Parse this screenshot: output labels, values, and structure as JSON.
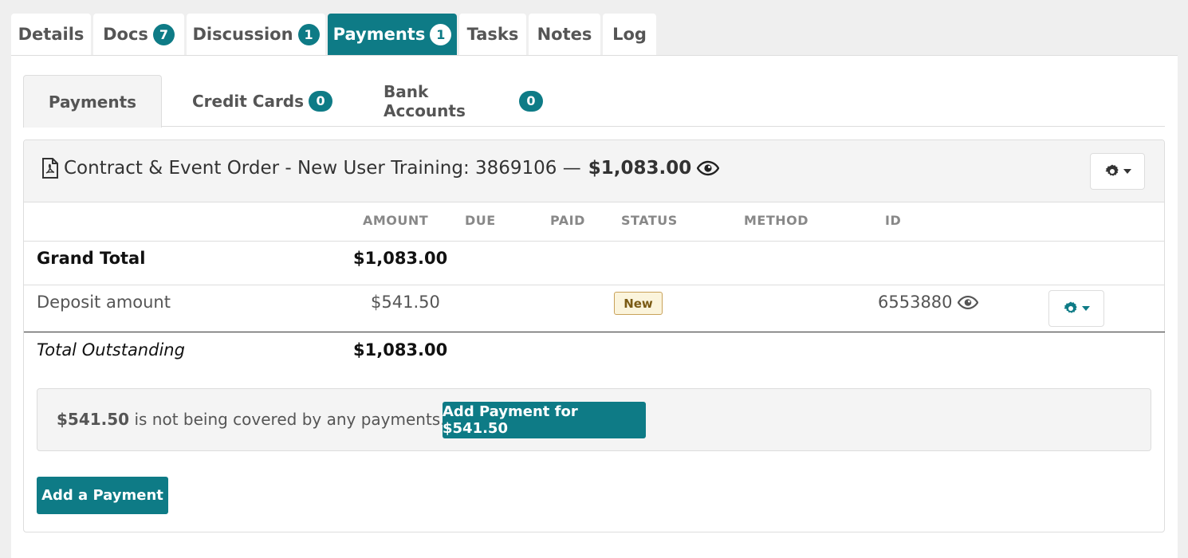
{
  "top_tabs": [
    {
      "label": "Details",
      "badge": ""
    },
    {
      "label": "Docs",
      "badge": "7"
    },
    {
      "label": "Discussion",
      "badge": "1"
    },
    {
      "label": "Payments",
      "badge": "1"
    },
    {
      "label": "Tasks",
      "badge": ""
    },
    {
      "label": "Notes",
      "badge": ""
    },
    {
      "label": "Log",
      "badge": ""
    }
  ],
  "active_top_tab": "Payments",
  "sub_tabs": [
    {
      "label": "Payments",
      "badge": ""
    },
    {
      "label": "Credit Cards",
      "badge": "0"
    },
    {
      "label": "Bank Accounts",
      "badge": "0"
    }
  ],
  "order": {
    "title": "Contract & Event Order - New User Training: 3869106 —",
    "amount": "$1,083.00",
    "icons": {
      "doc": "pdf-file-icon",
      "view": "eye-icon",
      "settings": "gear-icon"
    }
  },
  "table": {
    "columns": [
      "AMOUNT",
      "DUE",
      "PAID",
      "STATUS",
      "METHOD",
      "ID"
    ],
    "grand_total": {
      "label": "Grand Total",
      "amount": "$1,083.00"
    },
    "deposit": {
      "label": "Deposit amount",
      "amount": "$541.50",
      "status": "New",
      "id": "6553880"
    },
    "outstanding": {
      "label": "Total Outstanding",
      "amount": "$1,083.00"
    }
  },
  "uncovered": {
    "amount": "$541.50",
    "text": " is not being covered by any payments.",
    "button": "Add Payment for $541.50"
  },
  "add_payment_button": "Add a Payment",
  "colors": {
    "accent": "#0e7b86",
    "badge_new_bg": "#fbf4dc"
  }
}
